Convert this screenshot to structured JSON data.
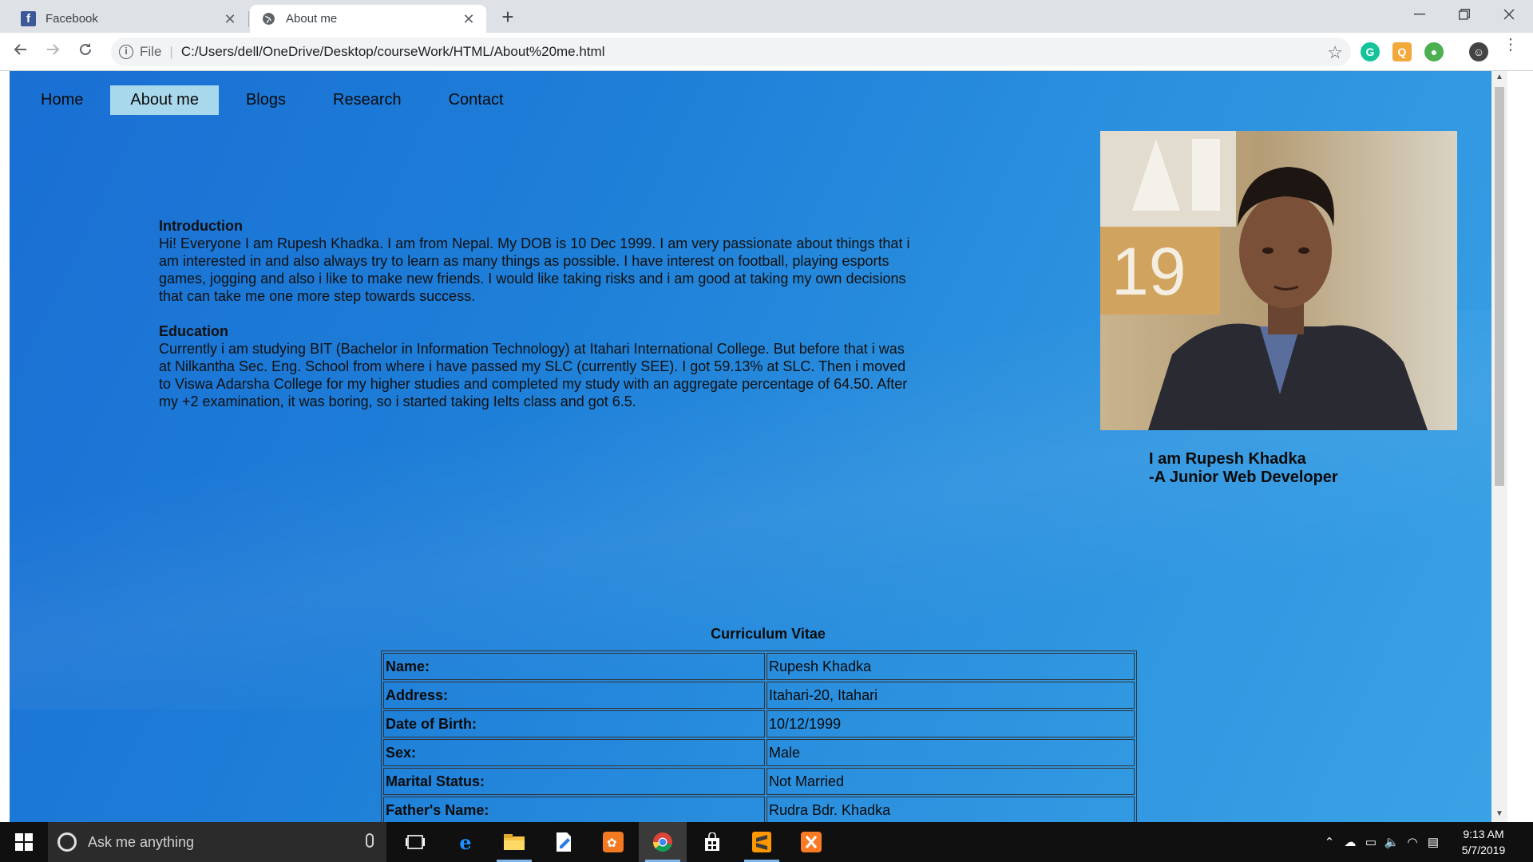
{
  "browser": {
    "tabs": [
      {
        "title": "Facebook",
        "favicon": "facebook-icon"
      },
      {
        "title": "About me",
        "favicon": "globe-icon"
      }
    ],
    "address": {
      "scheme": "File",
      "url": "C:/Users/dell/OneDrive/Desktop/courseWork/HTML/About%20me.html"
    }
  },
  "site": {
    "nav": [
      {
        "label": "Home"
      },
      {
        "label": "About me",
        "active": true
      },
      {
        "label": "Blogs"
      },
      {
        "label": "Research"
      },
      {
        "label": "Contact"
      }
    ],
    "intro": {
      "heading": "Introduction",
      "text": "Hi! Everyone I am Rupesh Khadka. I am from Nepal. My DOB is 10 Dec 1999. I am very passionate about things that i am interested in and also always try to learn as many things as possible. I have interest on football, playing esports games, jogging and also i like to make new friends. I would like taking risks and i am good at taking my own decisions that can take me one more step towards success."
    },
    "education": {
      "heading": "Education",
      "text": "Currently i am studying BIT (Bachelor in Information Technology) at Itahari International College. But before that i was at Nilkantha Sec. Eng. School from where i have passed my SLC (currently SEE). I got 59.13% at SLC. Then i moved to Viswa Adarsha College for my higher studies and completed my study with an aggregate percentage of 64.50. After my +2 examination, it was boring, so i started taking Ielts class and got 6.5."
    },
    "photo_digits": "19",
    "caption": {
      "line1": "I am Rupesh Khadka",
      "line2": "-A Junior Web Developer"
    },
    "cv": {
      "title": "Curriculum Vitae",
      "rows": [
        {
          "key": "Name:",
          "value": "Rupesh Khadka"
        },
        {
          "key": "Address:",
          "value": "Itahari-20, Itahari"
        },
        {
          "key": "Date of Birth:",
          "value": "10/12/1999"
        },
        {
          "key": "Sex:",
          "value": "Male"
        },
        {
          "key": "Marital Status:",
          "value": "Not Married"
        },
        {
          "key": "Father's Name:",
          "value": "Rudra Bdr. Khadka"
        }
      ]
    }
  },
  "taskbar": {
    "search_placeholder": "Ask me anything",
    "time": "9:13 AM",
    "date": "5/7/2019"
  },
  "colors": {
    "active_nav": "#a8d8ec",
    "page_bg": "#1e7fd8"
  }
}
